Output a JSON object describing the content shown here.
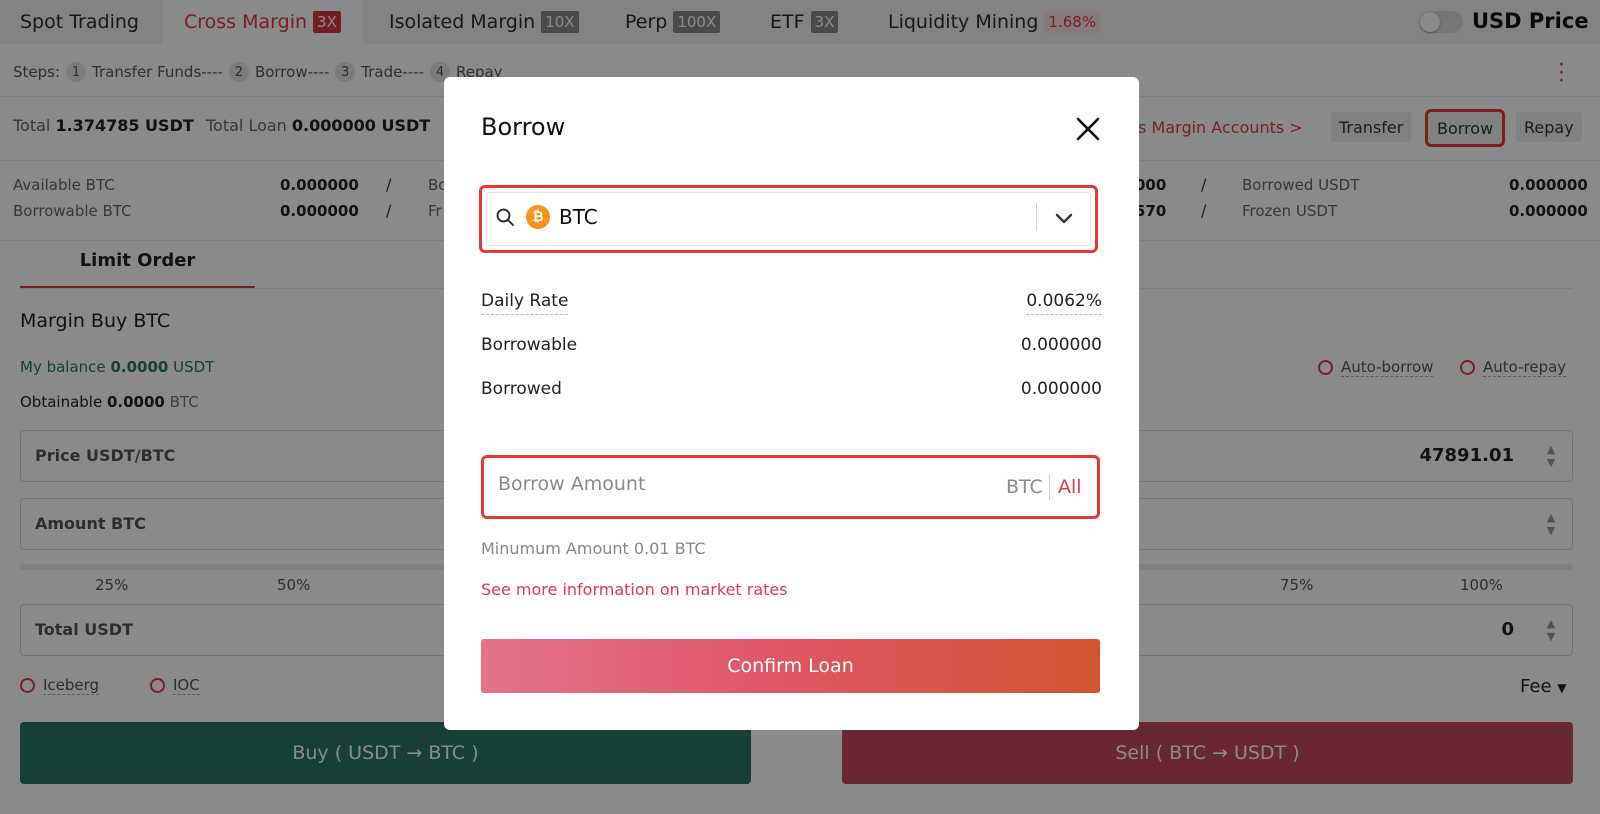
{
  "nav": {
    "tabs": [
      {
        "label": "Spot Trading",
        "badge": ""
      },
      {
        "label": "Cross Margin",
        "badge": "3X"
      },
      {
        "label": "Isolated Margin",
        "badge": "10X"
      },
      {
        "label": "Perp",
        "badge": "100X"
      },
      {
        "label": "ETF",
        "badge": "3X"
      },
      {
        "label": "Liquidity Mining",
        "badge": "1.68%"
      }
    ],
    "usd_price_label": "USD Price"
  },
  "steps": {
    "label": "Steps:",
    "items": [
      {
        "num": "1",
        "label": "Transfer Funds----"
      },
      {
        "num": "2",
        "label": "Borrow----"
      },
      {
        "num": "3",
        "label": "Trade----"
      },
      {
        "num": "4",
        "label": "Repay"
      }
    ]
  },
  "account": {
    "total_label": "Total",
    "total_value": "1.374785 USDT",
    "loan_label": "Total Loan",
    "loan_value": "0.000000 USDT",
    "accounts_link": "oss Margin Accounts >",
    "transfer_label": "Transfer",
    "borrow_label": "Borrow",
    "repay_label": "Repay"
  },
  "balances": {
    "left": [
      {
        "label": "Available BTC",
        "value": "0.000000",
        "sep": "/",
        "trail": "Bo"
      },
      {
        "label": "Borrowable BTC",
        "value": "0.000000",
        "sep": "/",
        "trail": "Fr"
      }
    ],
    "right": [
      {
        "lead": "000",
        "sep": "/",
        "label": "Borrowed USDT",
        "value": "0.000000"
      },
      {
        "lead": "570",
        "sep": "/",
        "label": "Frozen USDT",
        "value": "0.000000"
      }
    ]
  },
  "order": {
    "tab_label": "Limit Order",
    "title": "Margin Buy",
    "asset": "BTC",
    "my_balance_label": "My balance",
    "my_balance_value": "0.0000",
    "my_balance_unit": "USDT",
    "obtainable_label": "Obtainable",
    "obtainable_value": "0.0000",
    "obtainable_unit": "BTC",
    "price_placeholder": "Price USDT/BTC",
    "amount_placeholder": "Amount BTC",
    "total_placeholder": "Total USDT",
    "sell_price_value": "47891.01",
    "sell_total_value": "0",
    "pct_marks": [
      "25%",
      "50%",
      "75%",
      "100%"
    ],
    "iceberg_label": "Iceberg",
    "ioc_label": "IOC",
    "auto_borrow_label": "Auto-borrow",
    "auto_repay_label": "Auto-repay",
    "fee_label": "Fee",
    "buy_button": "Buy (   USDT  →  BTC   )",
    "sell_button": "Sell (   BTC  →  USDT   )"
  },
  "modal": {
    "title": "Borrow",
    "coin_symbol": "₿",
    "selected_coin": "BTC",
    "rows": [
      {
        "label": "Daily Rate",
        "value": "0.0062%"
      },
      {
        "label": "Borrowable",
        "value": "0.000000"
      },
      {
        "label": "Borrowed",
        "value": "0.000000"
      }
    ],
    "amount_placeholder": "Borrow Amount",
    "amount_unit": "BTC",
    "amount_all": "All",
    "min_hint": "Minumum Amount 0.01 BTC",
    "info_link": "See more information on market rates",
    "confirm_label": "Confirm Loan"
  },
  "colors": {
    "accent_red": "#e0384c",
    "highlight_box": "#e53935",
    "buy_green": "#2c7563",
    "sell_red": "#c34859"
  }
}
